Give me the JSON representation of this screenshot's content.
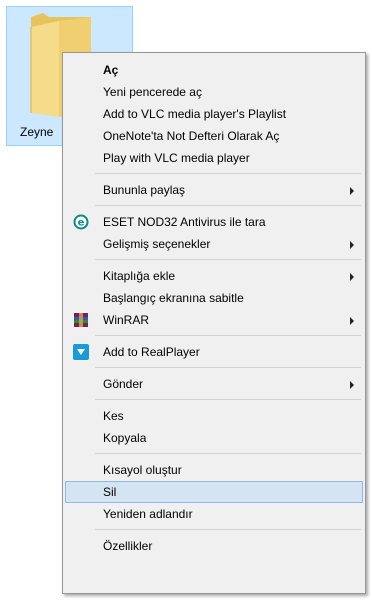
{
  "desktop": {
    "folder_label": "Zeyne"
  },
  "menu": {
    "items": [
      {
        "label": "Aç",
        "bold": true
      },
      {
        "label": "Yeni pencerede aç"
      },
      {
        "label": "Add to VLC media player's Playlist"
      },
      {
        "label": "OneNote'ta Not Defteri Olarak Aç"
      },
      {
        "label": "Play with VLC media player"
      },
      {
        "label": "Bununla paylaş",
        "submenu": true
      },
      {
        "label": "ESET NOD32 Antivirus ile tara",
        "icon": "eset-icon"
      },
      {
        "label": "Gelişmiş seçenekler",
        "submenu": true
      },
      {
        "label": "Kitaplığa ekle",
        "submenu": true
      },
      {
        "label": "Başlangıç ekranına sabitle"
      },
      {
        "label": "WinRAR",
        "icon": "winrar-icon",
        "submenu": true
      },
      {
        "label": "Add to RealPlayer",
        "icon": "realplayer-icon"
      },
      {
        "label": "Gönder",
        "submenu": true
      },
      {
        "label": "Kes"
      },
      {
        "label": "Kopyala"
      },
      {
        "label": "Kısayol oluştur"
      },
      {
        "label": "Sil",
        "highlighted": true
      },
      {
        "label": "Yeniden adlandır"
      },
      {
        "label": "Özellikler"
      }
    ]
  },
  "colors": {
    "selection_bg": "#cce8ff",
    "highlight_bg": "#d5e4f3",
    "menu_bg": "#f0f0f0",
    "eset_accent": "#0a8a8a",
    "realplayer_accent": "#1a9ad6"
  }
}
